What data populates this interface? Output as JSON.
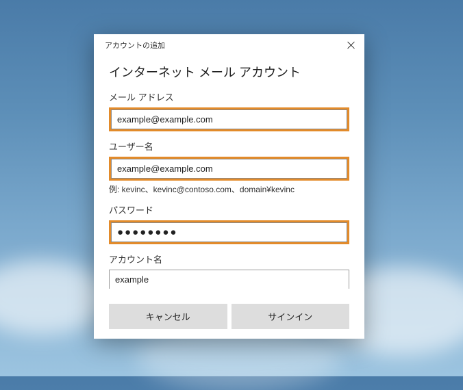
{
  "window": {
    "title": "アカウントの追加"
  },
  "form": {
    "heading": "インターネット メール アカウント",
    "email": {
      "label": "メール アドレス",
      "value": "example@example.com"
    },
    "username": {
      "label": "ユーザー名",
      "value": "example@example.com",
      "hint": "例: kevinc、kevinc@contoso.com、domain¥kevinc"
    },
    "password": {
      "label": "パスワード",
      "masked": "●●●●●●●●"
    },
    "accountName": {
      "label": "アカウント名",
      "value": "example"
    }
  },
  "buttons": {
    "cancel": "キャンセル",
    "signin": "サインイン"
  },
  "colors": {
    "highlight": "#e38b2a"
  }
}
